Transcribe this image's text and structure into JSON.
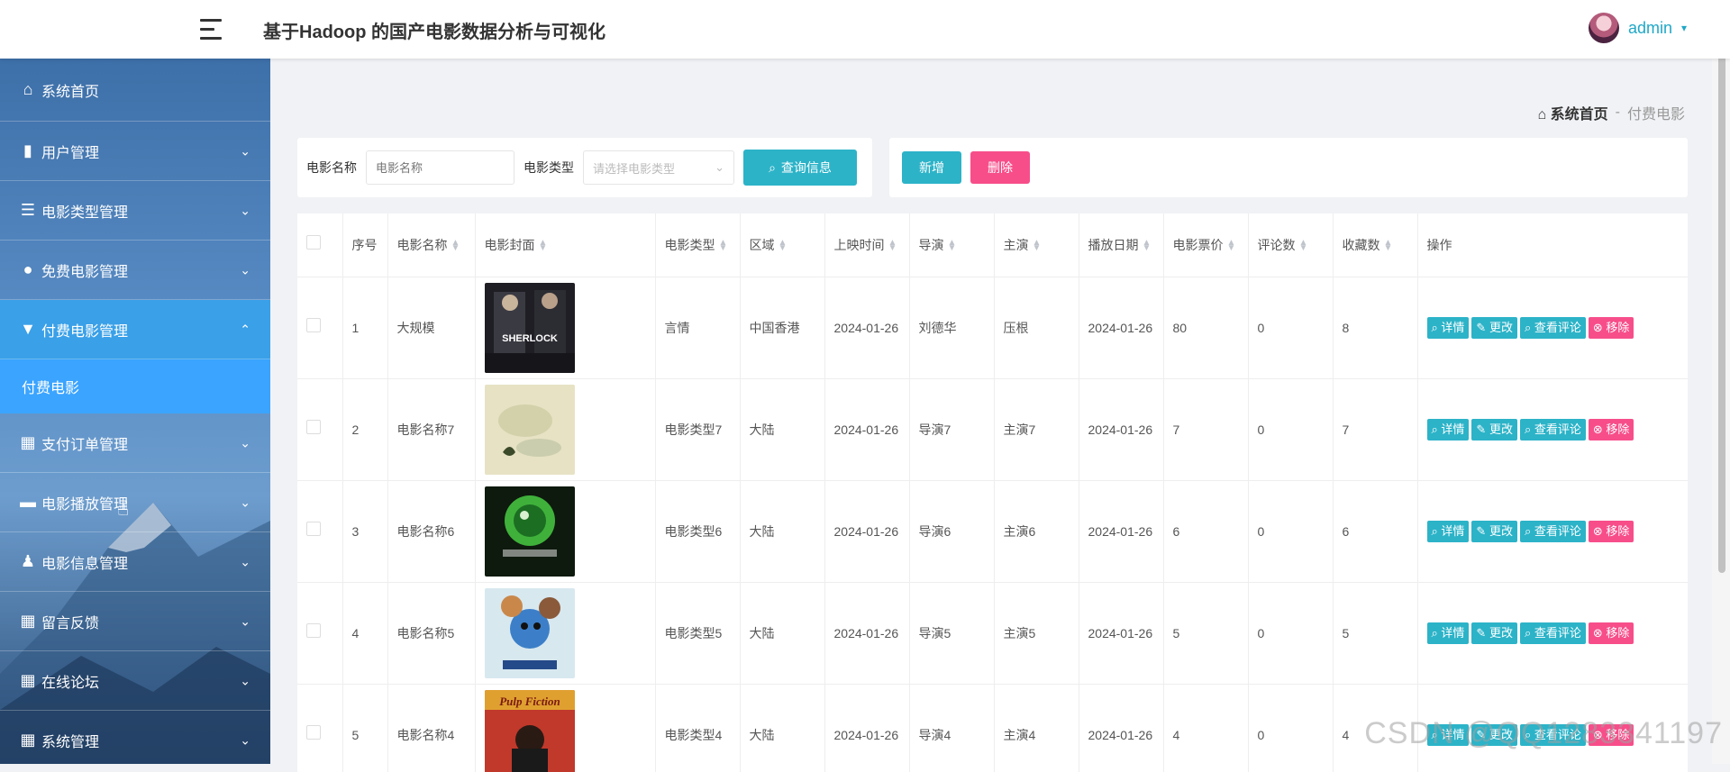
{
  "header": {
    "title": "基于Hadoop 的国产电影数据分析与可视化",
    "user_name": "admin",
    "caret": "▾"
  },
  "sidebar": {
    "items": [
      {
        "label": "系统首页",
        "icon": "home-icon",
        "glyph": "⌂",
        "chevron": ""
      },
      {
        "label": "用户管理",
        "icon": "bar-chart-icon",
        "glyph": "▮",
        "chevron": "⌄"
      },
      {
        "label": "电影类型管理",
        "icon": "list-icon",
        "glyph": "☰",
        "chevron": "⌄"
      },
      {
        "label": "免费电影管理",
        "icon": "lightbulb-icon",
        "glyph": "●",
        "chevron": "⌄"
      },
      {
        "label": "付费电影管理",
        "icon": "funnel-icon",
        "glyph": "▼",
        "chevron": "⌃"
      },
      {
        "label": "支付订单管理",
        "icon": "grid-icon",
        "glyph": "▦",
        "chevron": "⌄"
      },
      {
        "label": "电影播放管理",
        "icon": "briefcase-icon",
        "glyph": "▬",
        "chevron": "⌄"
      },
      {
        "label": "电影信息管理",
        "icon": "user-icon",
        "glyph": "♟",
        "chevron": "⌄"
      },
      {
        "label": "留言反馈",
        "icon": "apps-icon",
        "glyph": "▦",
        "chevron": "⌄"
      },
      {
        "label": "在线论坛",
        "icon": "grid-icon",
        "glyph": "▦",
        "chevron": "⌄"
      },
      {
        "label": "系统管理",
        "icon": "grid-icon",
        "glyph": "▦",
        "chevron": "⌄"
      }
    ],
    "submenu_item": "付费电影"
  },
  "breadcrumb": {
    "home": "系统首页",
    "sep": "-",
    "current": "付费电影"
  },
  "search": {
    "name_label": "电影名称",
    "name_placeholder": "电影名称",
    "type_label": "电影类型",
    "type_placeholder": "请选择电影类型",
    "query_button": "查询信息"
  },
  "actions": {
    "add": "新增",
    "delete": "删除"
  },
  "table": {
    "headers": [
      "序号",
      "电影名称",
      "电影封面",
      "电影类型",
      "区域",
      "上映时间",
      "导演",
      "主演",
      "播放日期",
      "电影票价",
      "评论数",
      "收藏数",
      "操作"
    ],
    "op_labels": {
      "detail": "详情",
      "edit": "更改",
      "comments": "查看评论",
      "remove": "移除"
    },
    "rows": [
      {
        "no": "1",
        "name": "大规模",
        "type": "言情",
        "region": "中国香港",
        "release": "2024-01-26",
        "director": "刘德华",
        "star": "压根",
        "play_date": "2024-01-26",
        "price": "80",
        "comments": "0",
        "favorites": "8",
        "cover_text": "SHERLOCK"
      },
      {
        "no": "2",
        "name": "电影名称7",
        "type": "电影类型7",
        "region": "大陆",
        "release": "2024-01-26",
        "director": "导演7",
        "star": "主演7",
        "play_date": "2024-01-26",
        "price": "7",
        "comments": "0",
        "favorites": "7",
        "cover_text": ""
      },
      {
        "no": "3",
        "name": "电影名称6",
        "type": "电影类型6",
        "region": "大陆",
        "release": "2024-01-26",
        "director": "导演6",
        "star": "主演6",
        "play_date": "2024-01-26",
        "price": "6",
        "comments": "0",
        "favorites": "6",
        "cover_text": ""
      },
      {
        "no": "4",
        "name": "电影名称5",
        "type": "电影类型5",
        "region": "大陆",
        "release": "2024-01-26",
        "director": "导演5",
        "star": "主演5",
        "play_date": "2024-01-26",
        "price": "5",
        "comments": "0",
        "favorites": "5",
        "cover_text": ""
      },
      {
        "no": "5",
        "name": "电影名称4",
        "type": "电影类型4",
        "region": "大陆",
        "release": "2024-01-26",
        "director": "导演4",
        "star": "主演4",
        "play_date": "2024-01-26",
        "price": "4",
        "comments": "0",
        "favorites": "4",
        "cover_text": "Pulp Fiction"
      }
    ]
  },
  "watermark": "CSDN @QQ1283341197",
  "colors": {
    "accent": "#2cb3c8",
    "danger": "#f74e8a",
    "active_menu": "#3aa0e8",
    "user": "#1fa8c7"
  }
}
